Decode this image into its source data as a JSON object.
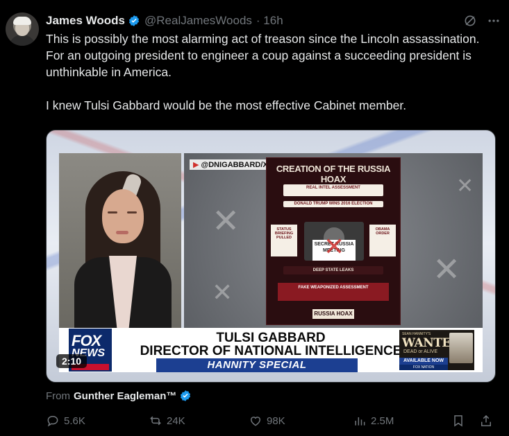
{
  "tweet": {
    "name": "James Woods",
    "handle": "@RealJamesWoods",
    "time": "· 16h",
    "text": "This is possibly the most alarming act of treason since the Lincoln assassination. For an outgoing president to engineer a coup against a succeeding president is unthinkable in America.\n\nI knew Tulsi Gabbard would be the most effective Cabinet member.",
    "more_icon": "more-icon",
    "grok_icon": "grok-icon"
  },
  "video": {
    "duration": "2:10",
    "dni_tag": "@DNIGABBARD/X",
    "poster": {
      "title": "CREATION OF THE RUSSIA HOAX",
      "box1": "REAL INTEL ASSESSMENT",
      "box2": "DONALD TRUMP WINS 2016 ELECTION",
      "left_box": "STATUS BRIEFING PULLED",
      "secret": "SECRET RUSSIA MEETING",
      "right_box": "OBAMA ORDER",
      "deep_state": "DEEP STATE LEAKS",
      "fake": "FAKE WEAPONIZED ASSESSMENT",
      "hoax": "RUSSIA HOAX"
    },
    "lower_third": {
      "name": "TULSI GABBARD",
      "title": "DIRECTOR OF NATIONAL INTELLIGENCE",
      "band": "HANNITY SPECIAL"
    },
    "network": {
      "line1": "FOX",
      "line2": "NEWS",
      "line3": "channel"
    },
    "promo": {
      "top": "SEAN HANNITY'S",
      "big": "WANTED",
      "sub": "DEAD or ALIVE",
      "available": "AVAILABLE NOW",
      "network": "FOX NATION"
    }
  },
  "attribution": {
    "prefix": "From",
    "name": "Gunther Eagleman™"
  },
  "actions": {
    "replies": "5.6K",
    "reposts": "24K",
    "likes": "98K",
    "views": "2.5M"
  },
  "colors": {
    "background": "#000000",
    "text": "#e7e9ea",
    "muted": "#71767b",
    "verified": "#1d9bf0"
  }
}
